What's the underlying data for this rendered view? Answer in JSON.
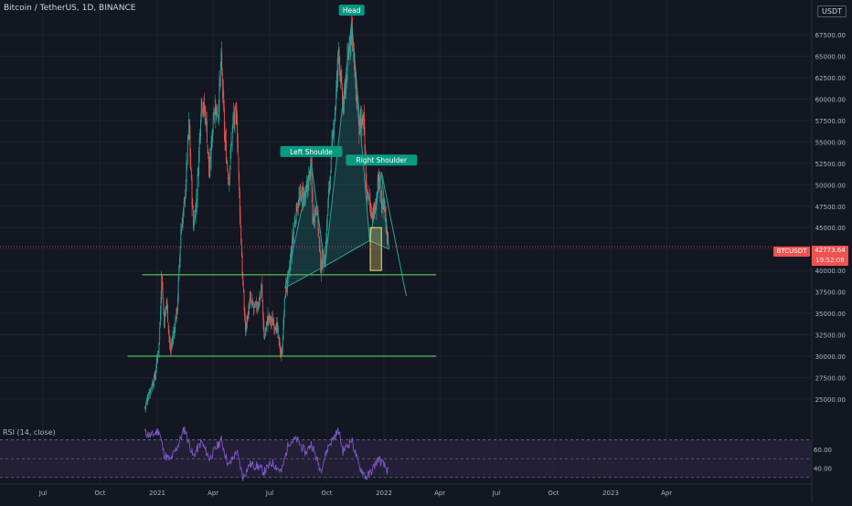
{
  "header": {
    "symbol_title": "Bitcoin / TetherUS, 1D, BINANCE",
    "currency": "USDT"
  },
  "indicator": {
    "label": "RSI (14, close)"
  },
  "last_price": {
    "symbol": "BTCUSDT",
    "value": "42773.64",
    "countdown": "19:52:08"
  },
  "colors": {
    "background": "#131722",
    "up": "#26a69a",
    "down": "#ef5350",
    "support_line": "#4caf50",
    "pattern_fill": "#26a69a",
    "label_bg": "#089981",
    "rsi_line": "#7e57c2",
    "rsi_band": "#2a2440",
    "highlight_box": "#f5e67a"
  },
  "chart_data": [
    {
      "type": "candlestick",
      "title": "Bitcoin / TetherUS, 1D, BINANCE",
      "x_ticks": [
        "Jul",
        "Oct",
        "2021",
        "Apr",
        "Jul",
        "Oct",
        "2022",
        "Apr",
        "Jul",
        "Oct",
        "2023",
        "Apr"
      ],
      "y_ticks": [
        25000,
        27500,
        30000,
        32500,
        35000,
        37500,
        40000,
        42500,
        45000,
        47500,
        50000,
        52500,
        55000,
        57500,
        60000,
        62500,
        65000,
        67500
      ],
      "ylim": [
        22000,
        70500
      ],
      "series": [
        {
          "name": "BTCUSDT",
          "points": [
            [
              "2020-12-12",
              24000
            ],
            [
              "2020-12-20",
              26000
            ],
            [
              "2020-12-28",
              27500
            ],
            [
              "2021-01-04",
              31500
            ],
            [
              "2021-01-08",
              39500
            ],
            [
              "2021-01-12",
              34000
            ],
            [
              "2021-01-16",
              36500
            ],
            [
              "2021-01-22",
              30500
            ],
            [
              "2021-01-28",
              33000
            ],
            [
              "2021-02-02",
              35500
            ],
            [
              "2021-02-08",
              44500
            ],
            [
              "2021-02-14",
              48000
            ],
            [
              "2021-02-21",
              57000
            ],
            [
              "2021-02-28",
              45000
            ],
            [
              "2021-03-06",
              49000
            ],
            [
              "2021-03-13",
              60000
            ],
            [
              "2021-03-20",
              58000
            ],
            [
              "2021-03-26",
              51000
            ],
            [
              "2021-04-02",
              59000
            ],
            [
              "2021-04-09",
              58500
            ],
            [
              "2021-04-14",
              64500
            ],
            [
              "2021-04-20",
              55000
            ],
            [
              "2021-04-26",
              50500
            ],
            [
              "2021-05-03",
              57500
            ],
            [
              "2021-05-09",
              58000
            ],
            [
              "2021-05-13",
              49000
            ],
            [
              "2021-05-19",
              38000
            ],
            [
              "2021-05-23",
              33000
            ],
            [
              "2021-05-30",
              36500
            ],
            [
              "2021-06-06",
              35500
            ],
            [
              "2021-06-12",
              36000
            ],
            [
              "2021-06-18",
              38000
            ],
            [
              "2021-06-22",
              32000
            ],
            [
              "2021-06-28",
              34500
            ],
            [
              "2021-07-05",
              34000
            ],
            [
              "2021-07-12",
              33500
            ],
            [
              "2021-07-20",
              29800
            ],
            [
              "2021-07-26",
              37500
            ],
            [
              "2021-08-01",
              39500
            ],
            [
              "2021-08-08",
              44500
            ],
            [
              "2021-08-14",
              47500
            ],
            [
              "2021-08-22",
              49000
            ],
            [
              "2021-08-28",
              48500
            ],
            [
              "2021-09-06",
              52500
            ],
            [
              "2021-09-08",
              46000
            ],
            [
              "2021-09-15",
              47500
            ],
            [
              "2021-09-21",
              40500
            ],
            [
              "2021-09-28",
              41500
            ],
            [
              "2021-10-04",
              49000
            ],
            [
              "2021-10-10",
              55000
            ],
            [
              "2021-10-15",
              59500
            ],
            [
              "2021-10-20",
              66000
            ],
            [
              "2021-10-27",
              58500
            ],
            [
              "2021-11-02",
              63000
            ],
            [
              "2021-11-10",
              69000
            ],
            [
              "2021-11-16",
              61500
            ],
            [
              "2021-11-22",
              56500
            ],
            [
              "2021-11-29",
              57500
            ],
            [
              "2021-12-04",
              49000
            ],
            [
              "2021-12-09",
              48000
            ],
            [
              "2021-12-13",
              46500
            ],
            [
              "2021-12-18",
              47000
            ],
            [
              "2021-12-23",
              50500
            ],
            [
              "2021-12-28",
              48000
            ],
            [
              "2022-01-02",
              47500
            ],
            [
              "2022-01-06",
              43500
            ],
            [
              "2022-01-09",
              42773.64
            ]
          ]
        }
      ],
      "horizontal_lines": [
        {
          "price": 39500,
          "from": "2020-12-08",
          "to": "2022-03-26"
        },
        {
          "price": 30000,
          "from": "2020-11-14",
          "to": "2022-03-26"
        }
      ],
      "annotations": [
        {
          "text": "Head",
          "x": "2021-11-10",
          "y": 69000
        },
        {
          "text": "Left Shoulde",
          "x": "2021-09-06",
          "y": 52500
        },
        {
          "text": "Right Shoulder",
          "x": "2021-12-28",
          "y": 51500
        }
      ],
      "pattern_triangles": [
        [
          [
            "2021-07-26",
            38000
          ],
          [
            "2021-09-06",
            52500
          ],
          [
            "2021-09-28",
            40500
          ]
        ],
        [
          [
            "2021-09-28",
            40500
          ],
          [
            "2021-11-10",
            69000
          ],
          [
            "2021-12-09",
            43500
          ]
        ],
        [
          [
            "2021-12-09",
            43500
          ],
          [
            "2021-12-28",
            51500
          ],
          [
            "2022-01-09",
            42500
          ]
        ]
      ],
      "projection_line": [
        [
          "2021-12-28",
          51500
        ],
        [
          "2022-02-06",
          37000
        ]
      ],
      "highlight_box": {
        "from": "2021-12-10",
        "to": "2021-12-28",
        "low": 40000,
        "high": 45000
      }
    },
    {
      "type": "line",
      "title": "RSI (14, close)",
      "y_ticks": [
        40,
        60
      ],
      "ylim": [
        25,
        85
      ],
      "bands": [
        30,
        50,
        70
      ],
      "series": [
        {
          "name": "RSI",
          "points": [
            [
              "2020-12-12",
              78
            ],
            [
              "2020-12-22",
              74
            ],
            [
              "2021-01-04",
              80
            ],
            [
              "2021-01-12",
              55
            ],
            [
              "2021-01-22",
              48
            ],
            [
              "2021-02-02",
              62
            ],
            [
              "2021-02-14",
              82
            ],
            [
              "2021-02-28",
              52
            ],
            [
              "2021-03-13",
              68
            ],
            [
              "2021-03-26",
              50
            ],
            [
              "2021-04-14",
              70
            ],
            [
              "2021-04-26",
              42
            ],
            [
              "2021-05-09",
              58
            ],
            [
              "2021-05-19",
              30
            ],
            [
              "2021-05-30",
              44
            ],
            [
              "2021-06-12",
              42
            ],
            [
              "2021-06-22",
              36
            ],
            [
              "2021-07-05",
              46
            ],
            [
              "2021-07-20",
              36
            ],
            [
              "2021-08-01",
              68
            ],
            [
              "2021-08-14",
              70
            ],
            [
              "2021-08-28",
              56
            ],
            [
              "2021-09-06",
              66
            ],
            [
              "2021-09-21",
              38
            ],
            [
              "2021-10-04",
              64
            ],
            [
              "2021-10-20",
              80
            ],
            [
              "2021-10-27",
              58
            ],
            [
              "2021-11-10",
              70
            ],
            [
              "2021-11-22",
              42
            ],
            [
              "2021-12-04",
              30
            ],
            [
              "2021-12-13",
              38
            ],
            [
              "2021-12-23",
              50
            ],
            [
              "2022-01-02",
              42
            ],
            [
              "2022-01-09",
              35
            ]
          ]
        }
      ]
    }
  ]
}
